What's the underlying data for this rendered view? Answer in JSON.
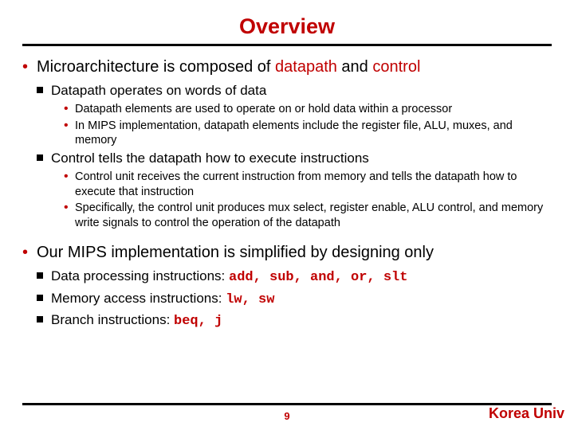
{
  "title": "Overview",
  "s1": {
    "l1": {
      "pre": "Microarchitecture is composed of ",
      "hl1": "datapath",
      "mid": " and ",
      "hl2": "control"
    },
    "l2a": "Datapath operates on words of data",
    "l3a": "Datapath elements are used to operate on or hold data within a processor",
    "l3b": "In MIPS implementation, datapath elements include the register file, ALU, muxes, and memory",
    "l2b": "Control tells the datapath how to execute instructions",
    "l3c": "Control unit receives the current instruction from memory and tells the datapath how to execute that instruction",
    "l3d": "Specifically, the control unit produces mux select, register enable, ALU control, and memory write signals to control the operation of the datapath"
  },
  "s2": {
    "l1": "Our MIPS implementation is simplified by designing only",
    "l2a": {
      "label": "Data processing instructions: ",
      "code": "add, sub, and, or, slt"
    },
    "l2b": {
      "label": "Memory access instructions: ",
      "code": "lw, sw"
    },
    "l2c": {
      "label": "Branch instructions: ",
      "code": "beq, j"
    }
  },
  "page": "9",
  "brand": "Korea Univ"
}
